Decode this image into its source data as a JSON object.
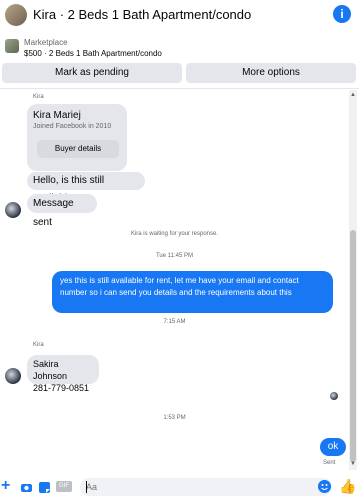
{
  "header": {
    "title": "Kira · 2 Beds 1 Bath Apartment/condo",
    "info_glyph": "i"
  },
  "marketplace": {
    "category": "Marketplace",
    "listing": "$500 · 2 Beds 1 Bath Apartment/condo"
  },
  "actions": {
    "mark_pending": "Mark as pending",
    "more_options": "More options"
  },
  "conversation": {
    "sender_name": "Kira",
    "card": {
      "name": "Kira Mariej",
      "subtitle": "Joined Facebook in 2010",
      "button": "Buyer details"
    },
    "incoming_1": "Hello, is this still available?",
    "incoming_2": "Message sent",
    "waiting_notice": "Kira is waiting for your response.",
    "timestamp_1": "Tue 11:45 PM",
    "outgoing_1": "yes this is still available for rent, let me have your email  and contact number so i can send you details and the requirements about this",
    "timestamp_2": "7:15 AM",
    "sender_name_2": "Kira",
    "incoming_3_line1": "Sakira Johnson",
    "incoming_3_line2": "281-779-0851",
    "timestamp_3": "1:53 PM",
    "outgoing_2": "ok",
    "sent_status": "Sent"
  },
  "composer": {
    "placeholder": "Aa",
    "gif_label": "GIF"
  },
  "colors": {
    "accent": "#1877f2",
    "bubble_gray": "#e4e6eb",
    "secondary_text": "#65676b"
  },
  "icons": [
    "info-icon",
    "plus-icon",
    "camera-icon",
    "sticker-icon",
    "gif-icon",
    "emoji-icon",
    "like-icon"
  ]
}
